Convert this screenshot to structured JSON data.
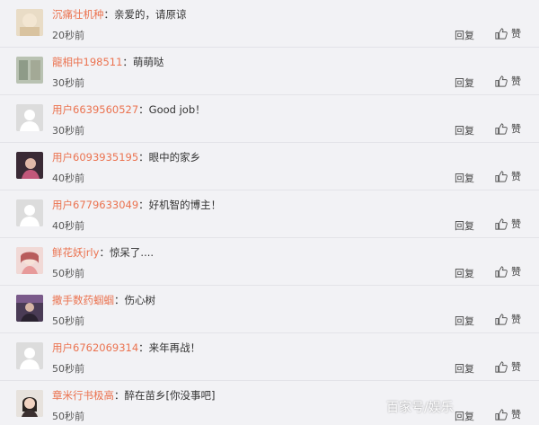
{
  "comments": [
    {
      "user": "沉痛壮机种",
      "text": "亲爱的，请原谅",
      "time": "20秒前",
      "reply": "回复",
      "like": "赞",
      "avatar": "photo"
    },
    {
      "user": "龍相中198511",
      "text": "萌萌哒",
      "time": "30秒前",
      "reply": "回复",
      "like": "赞",
      "avatar": "photo"
    },
    {
      "user": "用户6639560527",
      "text": "Good job！",
      "time": "30秒前",
      "reply": "回复",
      "like": "赞",
      "avatar": "default"
    },
    {
      "user": "用户6093935195",
      "text": "眼中的家乡",
      "time": "40秒前",
      "reply": "回复",
      "like": "赞",
      "avatar": "photo"
    },
    {
      "user": "用户6779633049",
      "text": "好机智的博主！",
      "time": "40秒前",
      "reply": "回复",
      "like": "赞",
      "avatar": "default"
    },
    {
      "user": "鲜花妖jrly",
      "text": "惊呆了....",
      "time": "50秒前",
      "reply": "回复",
      "like": "赞",
      "avatar": "photo"
    },
    {
      "user": "撒手数药蝈蝈",
      "text": "伤心树",
      "time": "50秒前",
      "reply": "回复",
      "like": "赞",
      "avatar": "photo"
    },
    {
      "user": "用户6762069314",
      "text": "来年再战！",
      "time": "50秒前",
      "reply": "回复",
      "like": "赞",
      "avatar": "default"
    },
    {
      "user": "章米行书极高",
      "text": "醉在苗乡[你没事吧]",
      "time": "50秒前",
      "reply": "回复",
      "like": "赞",
      "avatar": "photo"
    }
  ],
  "colors": {
    "username": "#eb7350",
    "text": "#333333",
    "background": "#f2f2f5"
  },
  "icons": {
    "like": "thumbs-up-icon",
    "avatar_default": "default-avatar-icon"
  },
  "watermark": "百家号/娱乐"
}
